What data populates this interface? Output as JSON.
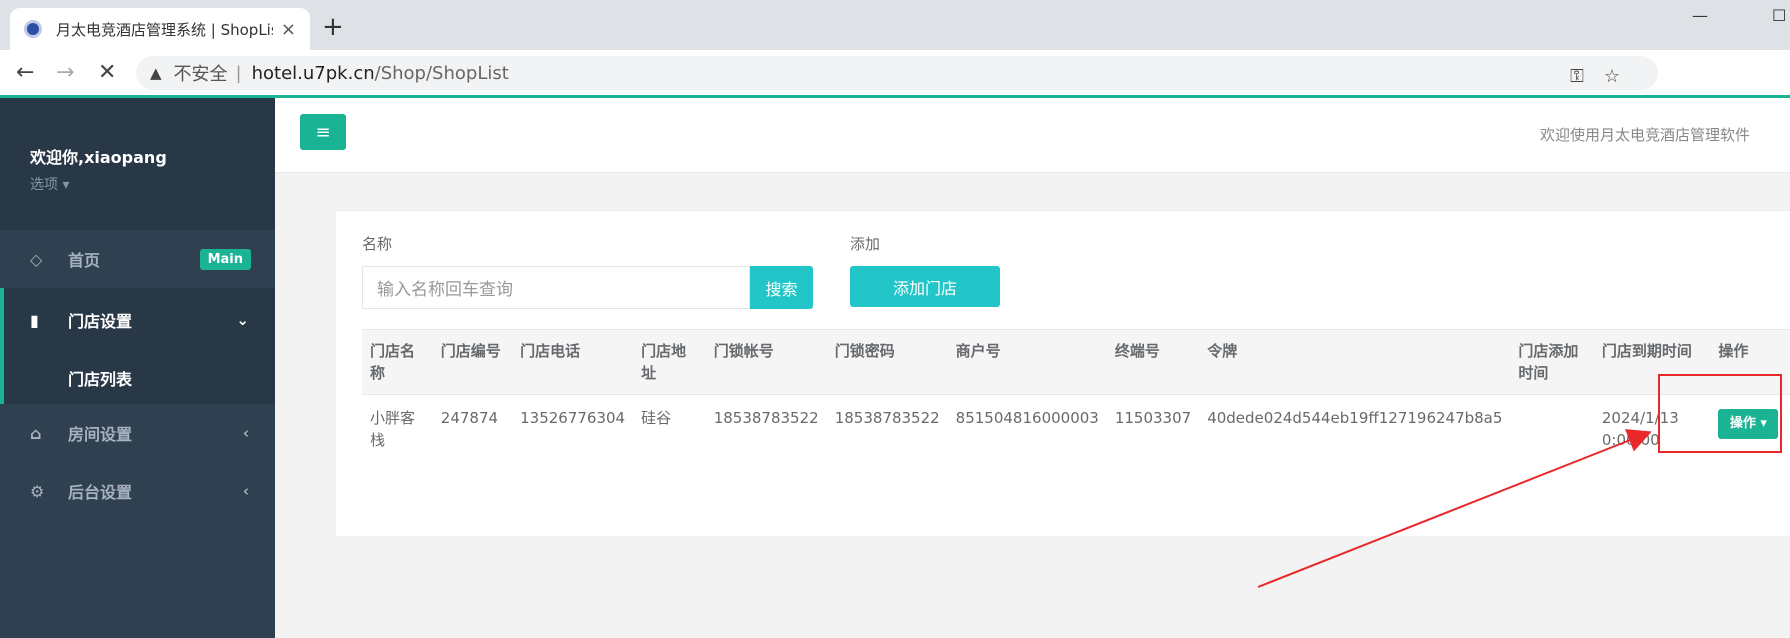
{
  "browser": {
    "tab_title": "月太电竞酒店管理系统 | ShopLis",
    "tab_close": "×",
    "new_tab": "+",
    "minimize": "—",
    "maximize": "☐",
    "security_label": "不安全",
    "separator": "|",
    "url_host": "hotel.u7pk.cn",
    "url_path": "/Shop/ShopList",
    "back": "←",
    "forward": "→",
    "stop": "✕",
    "omnibox_icons": "⚿☆"
  },
  "sidebar": {
    "welcome_user": "欢迎你,xiaopang",
    "options_label": "选项 ▾",
    "items": [
      {
        "label": "首页",
        "icon": "◇",
        "badge": "Main"
      },
      {
        "label": "门店设置",
        "icon": "▮",
        "chevron": "⌄"
      },
      {
        "label": "门店列表"
      },
      {
        "label": "房间设置",
        "icon": "⌂",
        "chevron": "‹"
      },
      {
        "label": "后台设置",
        "icon": "⚙",
        "chevron": "‹"
      }
    ]
  },
  "header": {
    "menu_icon": "≡",
    "welcome_text": "欢迎使用月太电竞酒店管理软件"
  },
  "filters": {
    "name_label": "名称",
    "name_placeholder": "输入名称回车查询",
    "search_button": "搜索",
    "add_label": "添加",
    "add_button": "添加门店"
  },
  "table": {
    "headers": [
      "门店名称",
      "门店编号",
      "门店电话",
      "门店地址",
      "门锁帐号",
      "门锁密码",
      "商户号",
      "终端号",
      "令牌",
      "门店添加时间",
      "门店到期时间",
      "操作"
    ],
    "rows": [
      {
        "cells": [
          "小胖客栈",
          "247874",
          "13526776304",
          "硅谷",
          "18538783522",
          "18538783522",
          "851504816000003",
          "11503307",
          "40dede024d544eb19ff127196247b8a5",
          "",
          "2024/1/13 0:00:00"
        ],
        "action_label": "操作 ▾"
      }
    ]
  },
  "colors": {
    "accent": "#1ab394",
    "info": "#23c6c8",
    "sidebar": "#2f4050",
    "annotation": "#e8282a"
  }
}
